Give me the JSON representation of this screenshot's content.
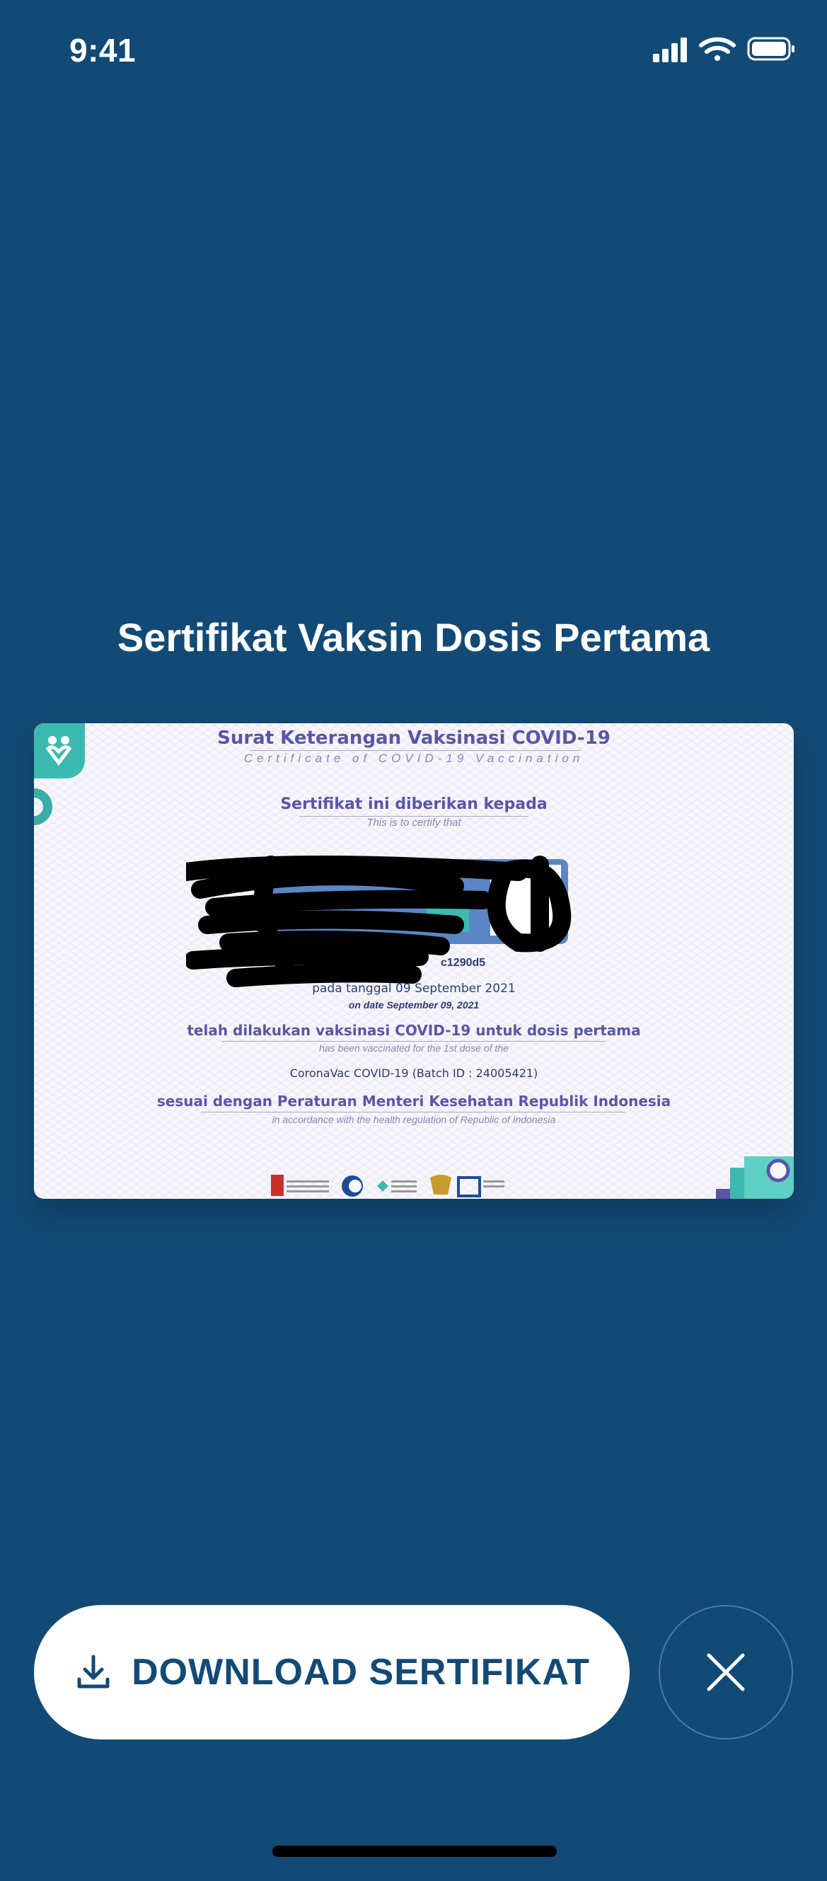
{
  "status_bar": {
    "time": "9:41"
  },
  "screen_title": "Sertifikat Vaksin Dosis Pertama",
  "certificate": {
    "title": "Surat Keterangan Vaksinasi COVID-19",
    "subtitle": "Certificate of COVID-19 Vaccination",
    "given_to": "Sertifikat ini diberikan kepada",
    "given_to_en": "This is to certify that",
    "id_fragment": "c1290d5",
    "date_line": "pada tanggal 09 September 2021",
    "date_line_en": "on date September 09, 2021",
    "vaccinated_line": "telah dilakukan vaksinasi COVID-19 untuk dosis pertama",
    "vaccinated_line_en": "has been vaccinated for the 1st dose of the",
    "vaccine": "CoronaVac COVID-19 (Batch ID : 24005421)",
    "regulation_line": "sesuai dengan Peraturan Menteri Kesehatan Republik Indonesia",
    "regulation_line_en": "in accordance with the health regulation of Republic of Indonesia"
  },
  "actions": {
    "download_label": "DOWNLOAD SERTIFIKAT",
    "download_icon": "download-icon",
    "close_icon": "close-icon"
  },
  "colors": {
    "background": "#124a75",
    "button_text": "#124a75",
    "cert_heading": "#5a56a6",
    "cert_text": "#2c3c74",
    "accent_teal": "#3dbab0"
  }
}
